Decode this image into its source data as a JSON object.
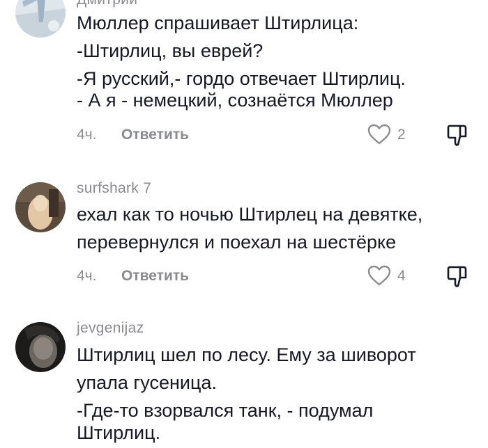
{
  "comments": [
    {
      "username": "Дмитрий",
      "lines": [
        "Мюллер спрашивает Штирлица:",
        "-Штирлиц, вы еврей?",
        "-Я русский,- гордо отвечает Штирлиц.",
        "- А я - немецкий, сознаётся Мюллер"
      ],
      "time": "4ч.",
      "reply_label": "Ответить",
      "likes": "2"
    },
    {
      "username": "surfshark 7",
      "lines": [
        "ехал как то ночью Штирлец на девятке,",
        "перевернулся и поехал на шестёрке"
      ],
      "time": "4ч.",
      "reply_label": "Ответить",
      "likes": "4"
    },
    {
      "username": "jevgenijaz",
      "lines": [
        "Штирлиц шел по лесу. Ему за шиворот",
        "упала гусеница.",
        "-Где-то взорвался танк, - подумал",
        "Штирлиц."
      ]
    }
  ],
  "icons": {
    "like": "heart-outline-icon",
    "dislike": "thumbs-down-icon"
  },
  "colors": {
    "text": "#161823",
    "secondary": "#8a8b91",
    "background": "#ffffff"
  }
}
